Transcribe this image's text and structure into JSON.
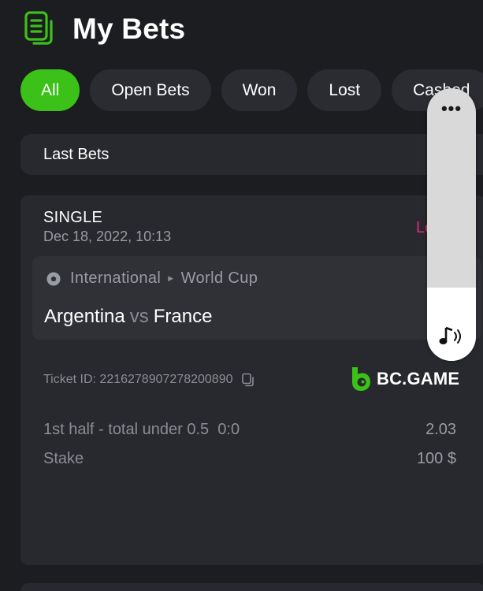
{
  "header": {
    "title": "My Bets",
    "icon": "bets-icon"
  },
  "tabs": [
    {
      "label": "All",
      "active": true
    },
    {
      "label": "Open Bets",
      "active": false
    },
    {
      "label": "Won",
      "active": false
    },
    {
      "label": "Lost",
      "active": false
    },
    {
      "label": "Cashed",
      "active": false
    }
  ],
  "section": {
    "title": "Last Bets"
  },
  "bet": {
    "type": "SINGLE",
    "date": "Dec 18, 2022, 10:13",
    "status": "Lost",
    "league": {
      "category": "International",
      "name": "World Cup"
    },
    "teams": {
      "home": "Argentina",
      "vs": "vs",
      "away": "France"
    },
    "ticket_id": "Ticket ID: 2216278907278200890",
    "brand": "BC.GAME",
    "selection": {
      "market": "1st half - total under 0.5",
      "score": "0:0",
      "odds": "2.03"
    },
    "stake": {
      "label": "Stake",
      "value": "100 $"
    }
  },
  "volume_overlay": {
    "menu": "•••",
    "level_fraction": 0.27
  },
  "colors": {
    "accent": "#3bc117",
    "lost": "#e3287d",
    "background": "#1c1d21",
    "card": "#27292e"
  }
}
